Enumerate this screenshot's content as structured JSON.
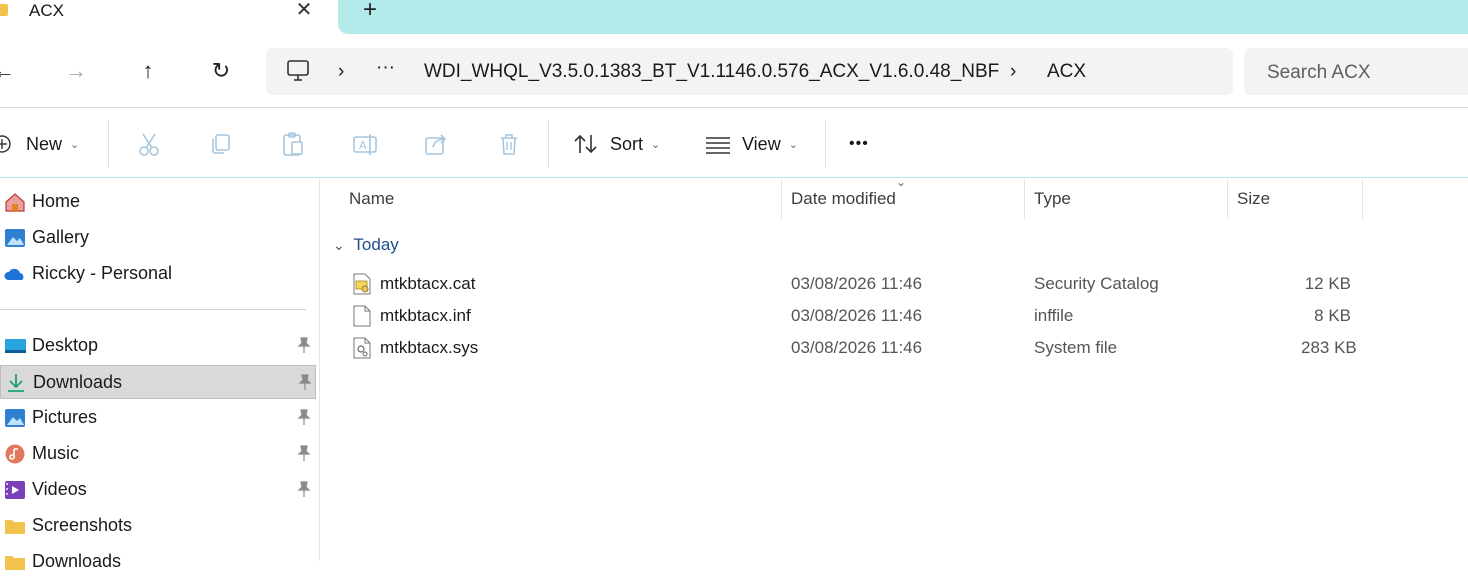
{
  "tab": {
    "title": "ACX",
    "close": "✕",
    "new": "+"
  },
  "nav": {
    "back": "←",
    "forward": "→",
    "up": "↑",
    "refresh": "↻"
  },
  "address": {
    "more": "···",
    "path": [
      "WDI_WHQL_V3.5.0.1383_BT_V1.1146.0.576_ACX_V1.6.0.48_NBF",
      "ACX"
    ],
    "separator": "›"
  },
  "search": {
    "placeholder": "Search ACX"
  },
  "toolbar": {
    "new_label": "New",
    "sort_label": "Sort",
    "view_label": "View",
    "more": "•••"
  },
  "sidebar": {
    "top_items": [
      {
        "label": "Home",
        "icon": "home-icon"
      },
      {
        "label": "Gallery",
        "icon": "gallery-icon"
      },
      {
        "label": "Riccky - Personal",
        "icon": "onedrive-cloud-icon"
      }
    ],
    "pinned_items": [
      {
        "label": "Desktop",
        "icon": "desktop-icon",
        "pinned": true
      },
      {
        "label": "Downloads",
        "icon": "downloads-icon",
        "pinned": true,
        "selected": true
      },
      {
        "label": "Pictures",
        "icon": "pictures-icon",
        "pinned": true
      },
      {
        "label": "Music",
        "icon": "music-icon",
        "pinned": true
      },
      {
        "label": "Videos",
        "icon": "videos-icon",
        "pinned": true
      },
      {
        "label": "Screenshots",
        "icon": "folder-icon",
        "pinned": false
      },
      {
        "label": "Downloads",
        "icon": "folder-icon",
        "pinned": false
      }
    ]
  },
  "columns": {
    "name": "Name",
    "date": "Date modified",
    "type": "Type",
    "size": "Size"
  },
  "group": {
    "label": "Today"
  },
  "files": [
    {
      "name": "mtkbtacx.cat",
      "date": "03/08/2026 11:46",
      "type": "Security Catalog",
      "size": "12 KB",
      "icon": "security-catalog-icon"
    },
    {
      "name": "mtkbtacx.inf",
      "date": "03/08/2026 11:46",
      "type": "inffile",
      "size": "8 KB",
      "icon": "blank-file-icon"
    },
    {
      "name": "mtkbtacx.sys",
      "date": "03/08/2026 11:46",
      "type": "System file",
      "size": "283 KB",
      "icon": "system-file-icon"
    }
  ],
  "colors": {
    "accent_tabstrip": "#b3ebea",
    "selected_bg": "#d9d9d9",
    "group_text": "#1f4e8c"
  }
}
